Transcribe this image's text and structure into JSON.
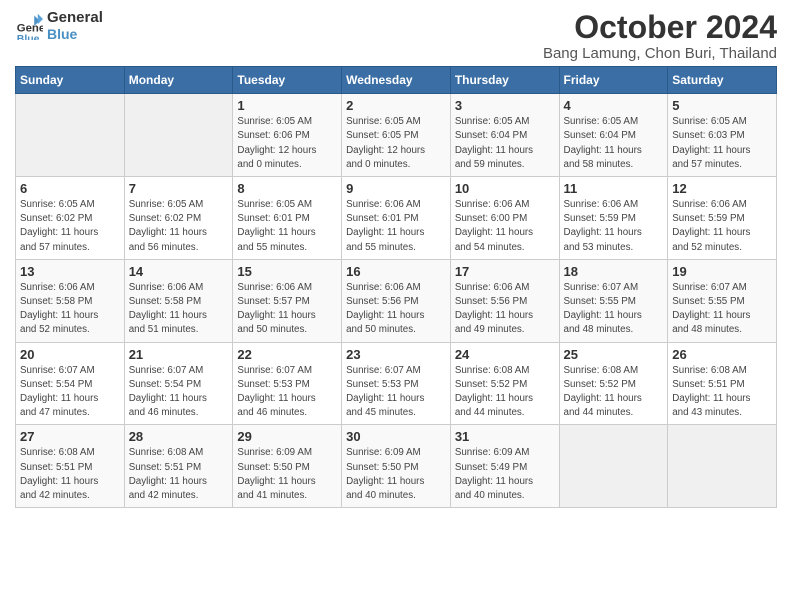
{
  "header": {
    "logo_line1": "General",
    "logo_line2": "Blue",
    "title": "October 2024",
    "subtitle": "Bang Lamung, Chon Buri, Thailand"
  },
  "weekdays": [
    "Sunday",
    "Monday",
    "Tuesday",
    "Wednesday",
    "Thursday",
    "Friday",
    "Saturday"
  ],
  "weeks": [
    [
      {
        "day": "",
        "info": ""
      },
      {
        "day": "",
        "info": ""
      },
      {
        "day": "1",
        "info": "Sunrise: 6:05 AM\nSunset: 6:06 PM\nDaylight: 12 hours\nand 0 minutes."
      },
      {
        "day": "2",
        "info": "Sunrise: 6:05 AM\nSunset: 6:05 PM\nDaylight: 12 hours\nand 0 minutes."
      },
      {
        "day": "3",
        "info": "Sunrise: 6:05 AM\nSunset: 6:04 PM\nDaylight: 11 hours\nand 59 minutes."
      },
      {
        "day": "4",
        "info": "Sunrise: 6:05 AM\nSunset: 6:04 PM\nDaylight: 11 hours\nand 58 minutes."
      },
      {
        "day": "5",
        "info": "Sunrise: 6:05 AM\nSunset: 6:03 PM\nDaylight: 11 hours\nand 57 minutes."
      }
    ],
    [
      {
        "day": "6",
        "info": "Sunrise: 6:05 AM\nSunset: 6:02 PM\nDaylight: 11 hours\nand 57 minutes."
      },
      {
        "day": "7",
        "info": "Sunrise: 6:05 AM\nSunset: 6:02 PM\nDaylight: 11 hours\nand 56 minutes."
      },
      {
        "day": "8",
        "info": "Sunrise: 6:05 AM\nSunset: 6:01 PM\nDaylight: 11 hours\nand 55 minutes."
      },
      {
        "day": "9",
        "info": "Sunrise: 6:06 AM\nSunset: 6:01 PM\nDaylight: 11 hours\nand 55 minutes."
      },
      {
        "day": "10",
        "info": "Sunrise: 6:06 AM\nSunset: 6:00 PM\nDaylight: 11 hours\nand 54 minutes."
      },
      {
        "day": "11",
        "info": "Sunrise: 6:06 AM\nSunset: 5:59 PM\nDaylight: 11 hours\nand 53 minutes."
      },
      {
        "day": "12",
        "info": "Sunrise: 6:06 AM\nSunset: 5:59 PM\nDaylight: 11 hours\nand 52 minutes."
      }
    ],
    [
      {
        "day": "13",
        "info": "Sunrise: 6:06 AM\nSunset: 5:58 PM\nDaylight: 11 hours\nand 52 minutes."
      },
      {
        "day": "14",
        "info": "Sunrise: 6:06 AM\nSunset: 5:58 PM\nDaylight: 11 hours\nand 51 minutes."
      },
      {
        "day": "15",
        "info": "Sunrise: 6:06 AM\nSunset: 5:57 PM\nDaylight: 11 hours\nand 50 minutes."
      },
      {
        "day": "16",
        "info": "Sunrise: 6:06 AM\nSunset: 5:56 PM\nDaylight: 11 hours\nand 50 minutes."
      },
      {
        "day": "17",
        "info": "Sunrise: 6:06 AM\nSunset: 5:56 PM\nDaylight: 11 hours\nand 49 minutes."
      },
      {
        "day": "18",
        "info": "Sunrise: 6:07 AM\nSunset: 5:55 PM\nDaylight: 11 hours\nand 48 minutes."
      },
      {
        "day": "19",
        "info": "Sunrise: 6:07 AM\nSunset: 5:55 PM\nDaylight: 11 hours\nand 48 minutes."
      }
    ],
    [
      {
        "day": "20",
        "info": "Sunrise: 6:07 AM\nSunset: 5:54 PM\nDaylight: 11 hours\nand 47 minutes."
      },
      {
        "day": "21",
        "info": "Sunrise: 6:07 AM\nSunset: 5:54 PM\nDaylight: 11 hours\nand 46 minutes."
      },
      {
        "day": "22",
        "info": "Sunrise: 6:07 AM\nSunset: 5:53 PM\nDaylight: 11 hours\nand 46 minutes."
      },
      {
        "day": "23",
        "info": "Sunrise: 6:07 AM\nSunset: 5:53 PM\nDaylight: 11 hours\nand 45 minutes."
      },
      {
        "day": "24",
        "info": "Sunrise: 6:08 AM\nSunset: 5:52 PM\nDaylight: 11 hours\nand 44 minutes."
      },
      {
        "day": "25",
        "info": "Sunrise: 6:08 AM\nSunset: 5:52 PM\nDaylight: 11 hours\nand 44 minutes."
      },
      {
        "day": "26",
        "info": "Sunrise: 6:08 AM\nSunset: 5:51 PM\nDaylight: 11 hours\nand 43 minutes."
      }
    ],
    [
      {
        "day": "27",
        "info": "Sunrise: 6:08 AM\nSunset: 5:51 PM\nDaylight: 11 hours\nand 42 minutes."
      },
      {
        "day": "28",
        "info": "Sunrise: 6:08 AM\nSunset: 5:51 PM\nDaylight: 11 hours\nand 42 minutes."
      },
      {
        "day": "29",
        "info": "Sunrise: 6:09 AM\nSunset: 5:50 PM\nDaylight: 11 hours\nand 41 minutes."
      },
      {
        "day": "30",
        "info": "Sunrise: 6:09 AM\nSunset: 5:50 PM\nDaylight: 11 hours\nand 40 minutes."
      },
      {
        "day": "31",
        "info": "Sunrise: 6:09 AM\nSunset: 5:49 PM\nDaylight: 11 hours\nand 40 minutes."
      },
      {
        "day": "",
        "info": ""
      },
      {
        "day": "",
        "info": ""
      }
    ]
  ]
}
